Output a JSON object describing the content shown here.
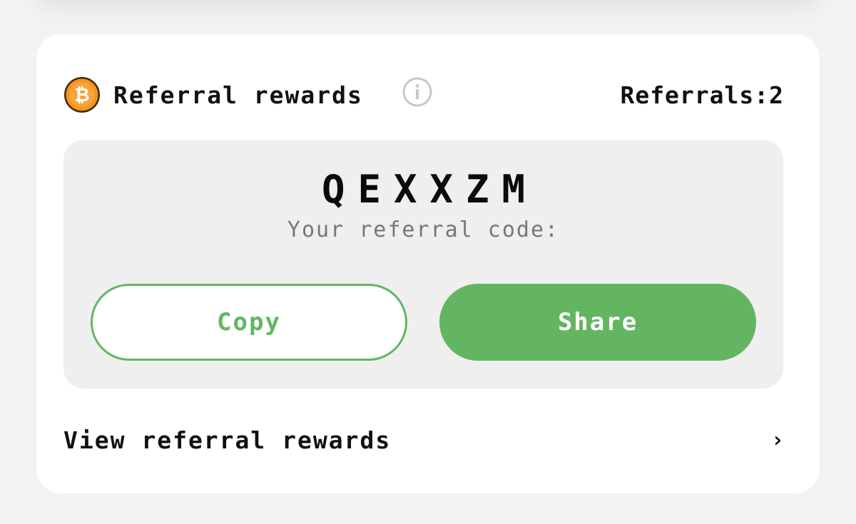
{
  "header": {
    "title": "Referral rewards",
    "coin_icon": "bitcoin-coin-icon",
    "info_icon": "info-icon",
    "referrals_label": "Referrals:2"
  },
  "code_panel": {
    "code": "QEXXZM",
    "label": "Your referral code:"
  },
  "buttons": {
    "copy_label": "Copy",
    "share_label": "Share"
  },
  "footer": {
    "view_rewards_label": "View referral rewards",
    "chevron_icon": "chevron-right-icon"
  },
  "colors": {
    "accent_green": "#64b562",
    "coin_orange": "#f7931a",
    "card_bg": "#ffffff",
    "panel_bg": "#efefef",
    "page_bg": "#f2f2f2"
  }
}
